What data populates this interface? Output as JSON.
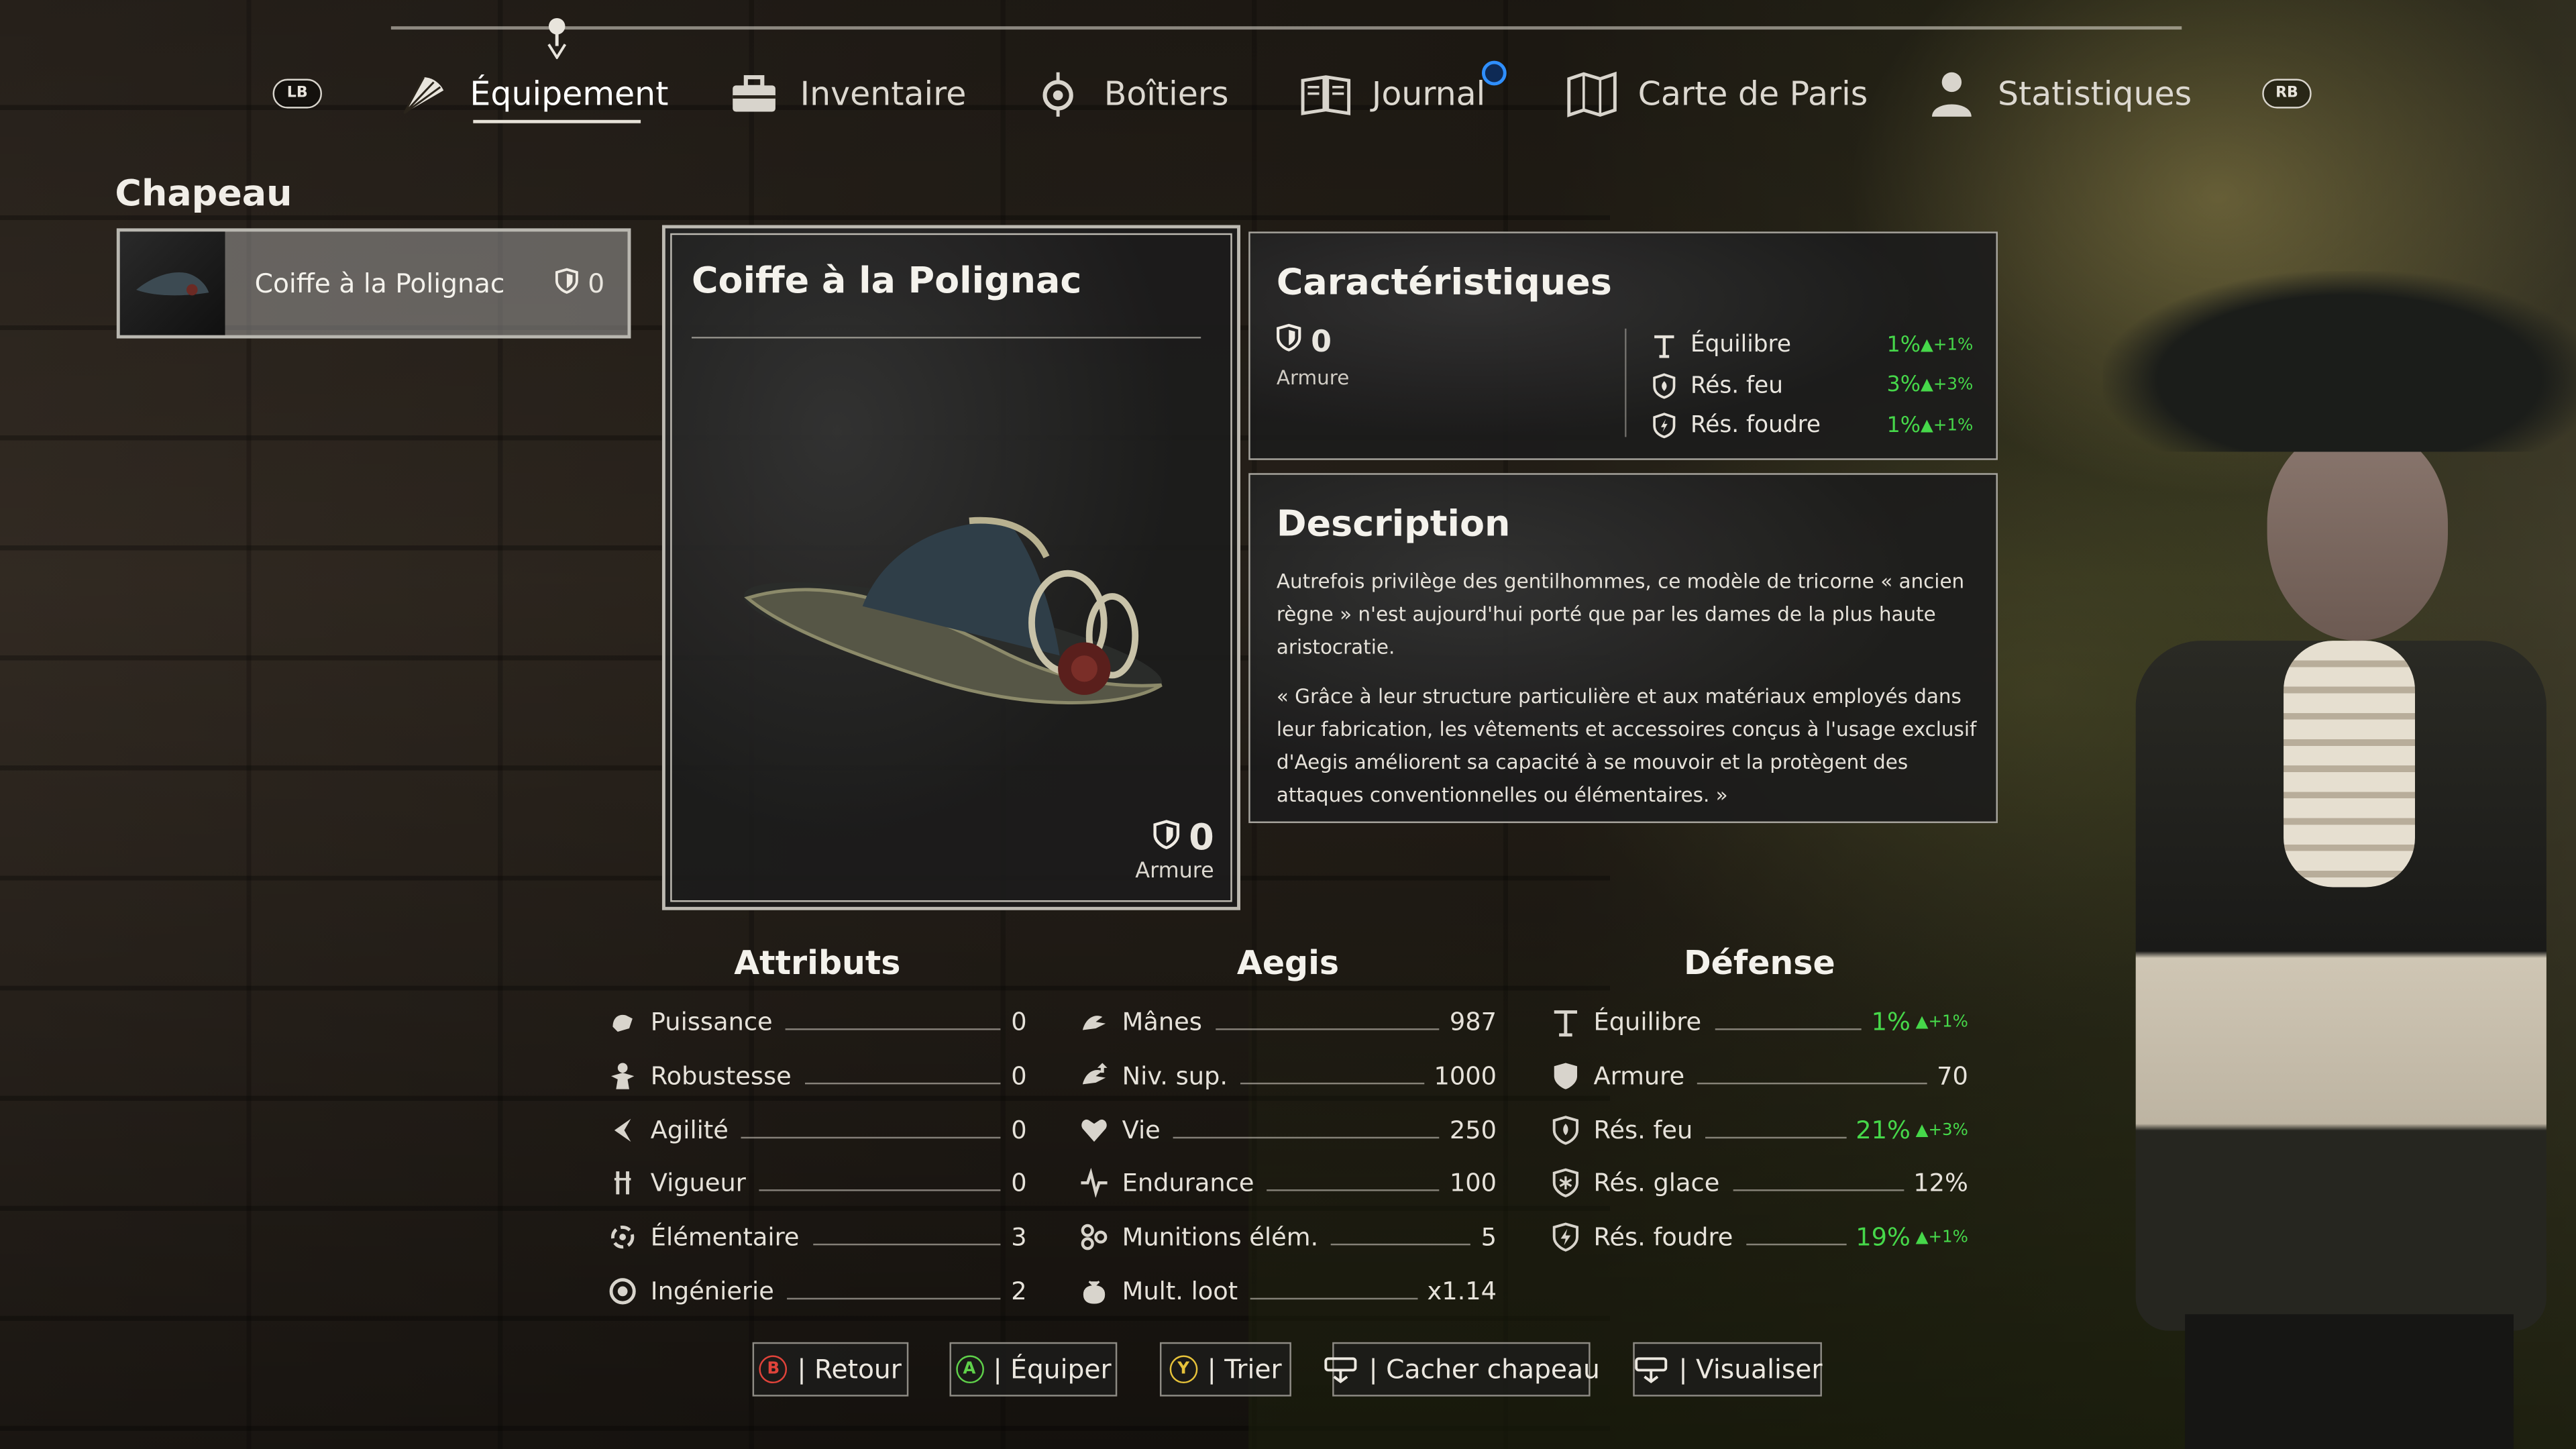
{
  "nav": {
    "lb": "LB",
    "rb": "RB",
    "tabs": [
      {
        "label": "Équipement"
      },
      {
        "label": "Inventaire"
      },
      {
        "label": "Boîtiers"
      },
      {
        "label": "Journal"
      },
      {
        "label": "Carte de Paris"
      },
      {
        "label": "Statistiques"
      }
    ]
  },
  "category": "Chapeau",
  "list": [
    {
      "name": "Coiffe à la Polignac",
      "armor": "0"
    }
  ],
  "item": {
    "title": "Coiffe à la Polignac",
    "armor_value": "0",
    "armor_label": "Armure"
  },
  "characteristics": {
    "title": "Caractéristiques",
    "armor_value": "0",
    "armor_label": "Armure",
    "stats": [
      {
        "name": "Équilibre",
        "value": "1%",
        "delta": "+1%"
      },
      {
        "name": "Rés. feu",
        "value": "3%",
        "delta": "+3%"
      },
      {
        "name": "Rés. foudre",
        "value": "1%",
        "delta": "+1%"
      }
    ]
  },
  "description": {
    "title": "Description",
    "p1": "Autrefois privilège des gentilhommes, ce modèle de tricorne « ancien règne » n'est aujourd'hui porté que par les dames de la plus haute aristocratie.",
    "p2": "« Grâce à leur structure particulière et aux matériaux employés dans leur fabrication, les vêtements et accessoires conçus à l'usage exclusif d'Aegis améliorent sa capacité à se mouvoir et la protègent des attaques conventionnelles ou élémentaires. »"
  },
  "attributs": {
    "title": "Attributs",
    "rows": [
      {
        "name": "Puissance",
        "value": "0"
      },
      {
        "name": "Robustesse",
        "value": "0"
      },
      {
        "name": "Agilité",
        "value": "0"
      },
      {
        "name": "Vigueur",
        "value": "0"
      },
      {
        "name": "Élémentaire",
        "value": "3"
      },
      {
        "name": "Ingénierie",
        "value": "2"
      }
    ]
  },
  "aegis": {
    "title": "Aegis",
    "rows": [
      {
        "name": "Mânes",
        "value": "987"
      },
      {
        "name": "Niv. sup.",
        "value": "1000"
      },
      {
        "name": "Vie",
        "value": "250"
      },
      {
        "name": "Endurance",
        "value": "100"
      },
      {
        "name": "Munitions élém.",
        "value": "5"
      },
      {
        "name": "Mult. loot",
        "value": "x1.14"
      }
    ]
  },
  "defense": {
    "title": "Défense",
    "rows": [
      {
        "name": "Équilibre",
        "value": "1%",
        "delta": "+1%"
      },
      {
        "name": "Armure",
        "value": "70",
        "delta": ""
      },
      {
        "name": "Rés. feu",
        "value": "21%",
        "delta": "+3%"
      },
      {
        "name": "Rés. glace",
        "value": "12%",
        "delta": ""
      },
      {
        "name": "Rés. foudre",
        "value": "19%",
        "delta": "+1%"
      }
    ]
  },
  "buttons": {
    "back": {
      "glyph": "B",
      "label": "| Retour"
    },
    "equip": {
      "glyph": "A",
      "label": "| Équiper"
    },
    "sort": {
      "glyph": "Y",
      "label": "| Trier"
    },
    "hide_hat": {
      "label": "| Cacher chapeau"
    },
    "view": {
      "label": "| Visualiser"
    }
  },
  "colors": {
    "positive": "#46d84a",
    "b_button": "#e0433a",
    "a_button": "#5fd14a",
    "y_button": "#e6c23a",
    "notification": "#2f8fff"
  }
}
